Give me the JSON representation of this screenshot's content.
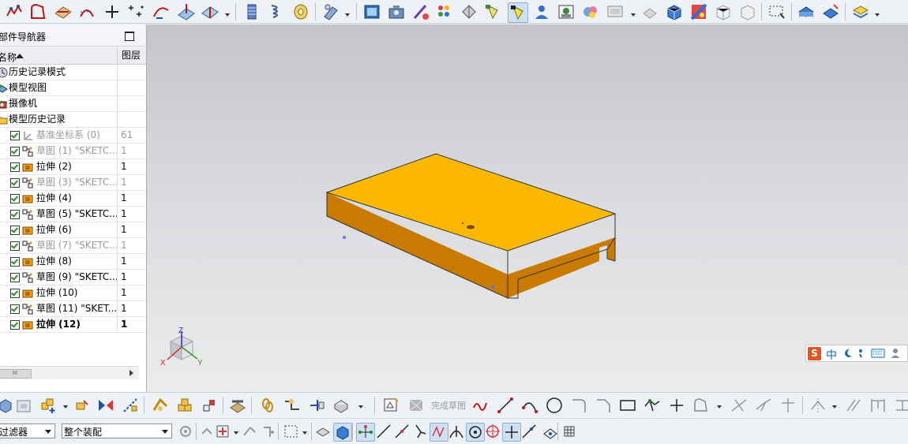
{
  "navigator": {
    "title": "部件导航器",
    "col_name": "名称",
    "col_layer": "图层",
    "items": [
      {
        "label": "历史记录模式",
        "layer": "",
        "indent": 0,
        "icon": "history-mode-icon",
        "state": "normal"
      },
      {
        "label": "模型视图",
        "layer": "",
        "indent": 0,
        "icon": "model-views-icon",
        "state": "normal"
      },
      {
        "label": "摄像机",
        "layer": "",
        "indent": 0,
        "icon": "camera-icon",
        "state": "normal"
      },
      {
        "label": "模型历史记录",
        "layer": "",
        "indent": 0,
        "icon": "folder-icon",
        "state": "normal"
      },
      {
        "label": "基准坐标系 (0)",
        "layer": "61",
        "indent": 1,
        "icon": "datum-csys-icon",
        "state": "grey"
      },
      {
        "label": "草图 (1) \"SKETC...",
        "layer": "1",
        "indent": 1,
        "icon": "sketch-icon",
        "state": "grey"
      },
      {
        "label": "拉伸 (2)",
        "layer": "1",
        "indent": 1,
        "icon": "extrude-icon",
        "state": "normal"
      },
      {
        "label": "草图 (3) \"SKETC...",
        "layer": "1",
        "indent": 1,
        "icon": "sketch-icon",
        "state": "grey"
      },
      {
        "label": "拉伸 (4)",
        "layer": "1",
        "indent": 1,
        "icon": "extrude-icon",
        "state": "normal"
      },
      {
        "label": "草图 (5) \"SKETC...",
        "layer": "1",
        "indent": 1,
        "icon": "sketch-icon",
        "state": "normal"
      },
      {
        "label": "拉伸 (6)",
        "layer": "1",
        "indent": 1,
        "icon": "extrude-icon",
        "state": "normal"
      },
      {
        "label": "草图 (7) \"SKETC...",
        "layer": "1",
        "indent": 1,
        "icon": "sketch-icon",
        "state": "grey"
      },
      {
        "label": "拉伸 (8)",
        "layer": "1",
        "indent": 1,
        "icon": "extrude-icon",
        "state": "normal"
      },
      {
        "label": "草图 (9) \"SKETC...",
        "layer": "1",
        "indent": 1,
        "icon": "sketch-icon",
        "state": "normal"
      },
      {
        "label": "拉伸 (10)",
        "layer": "1",
        "indent": 1,
        "icon": "extrude-icon",
        "state": "normal"
      },
      {
        "label": "草图 (11) \"SKET...",
        "layer": "1",
        "indent": 1,
        "icon": "sketch-icon",
        "state": "normal"
      },
      {
        "label": "拉伸 (12)",
        "layer": "1",
        "indent": 1,
        "icon": "extrude-icon",
        "state": "bold"
      }
    ],
    "scroll_thumb": "III"
  },
  "triad": {
    "x": "X",
    "y": "Y",
    "z": "Z"
  },
  "bottom": {
    "filter_value": "过滤器",
    "assembly_value": "整个装配",
    "finish_sketch": "完成草图"
  },
  "ime": {
    "brand": "S",
    "lang": "中"
  },
  "colors": {
    "part_top": "#ffb800",
    "part_side": "#c97a00",
    "part_edge": "#333333",
    "check_green": "#1f9a1f"
  }
}
